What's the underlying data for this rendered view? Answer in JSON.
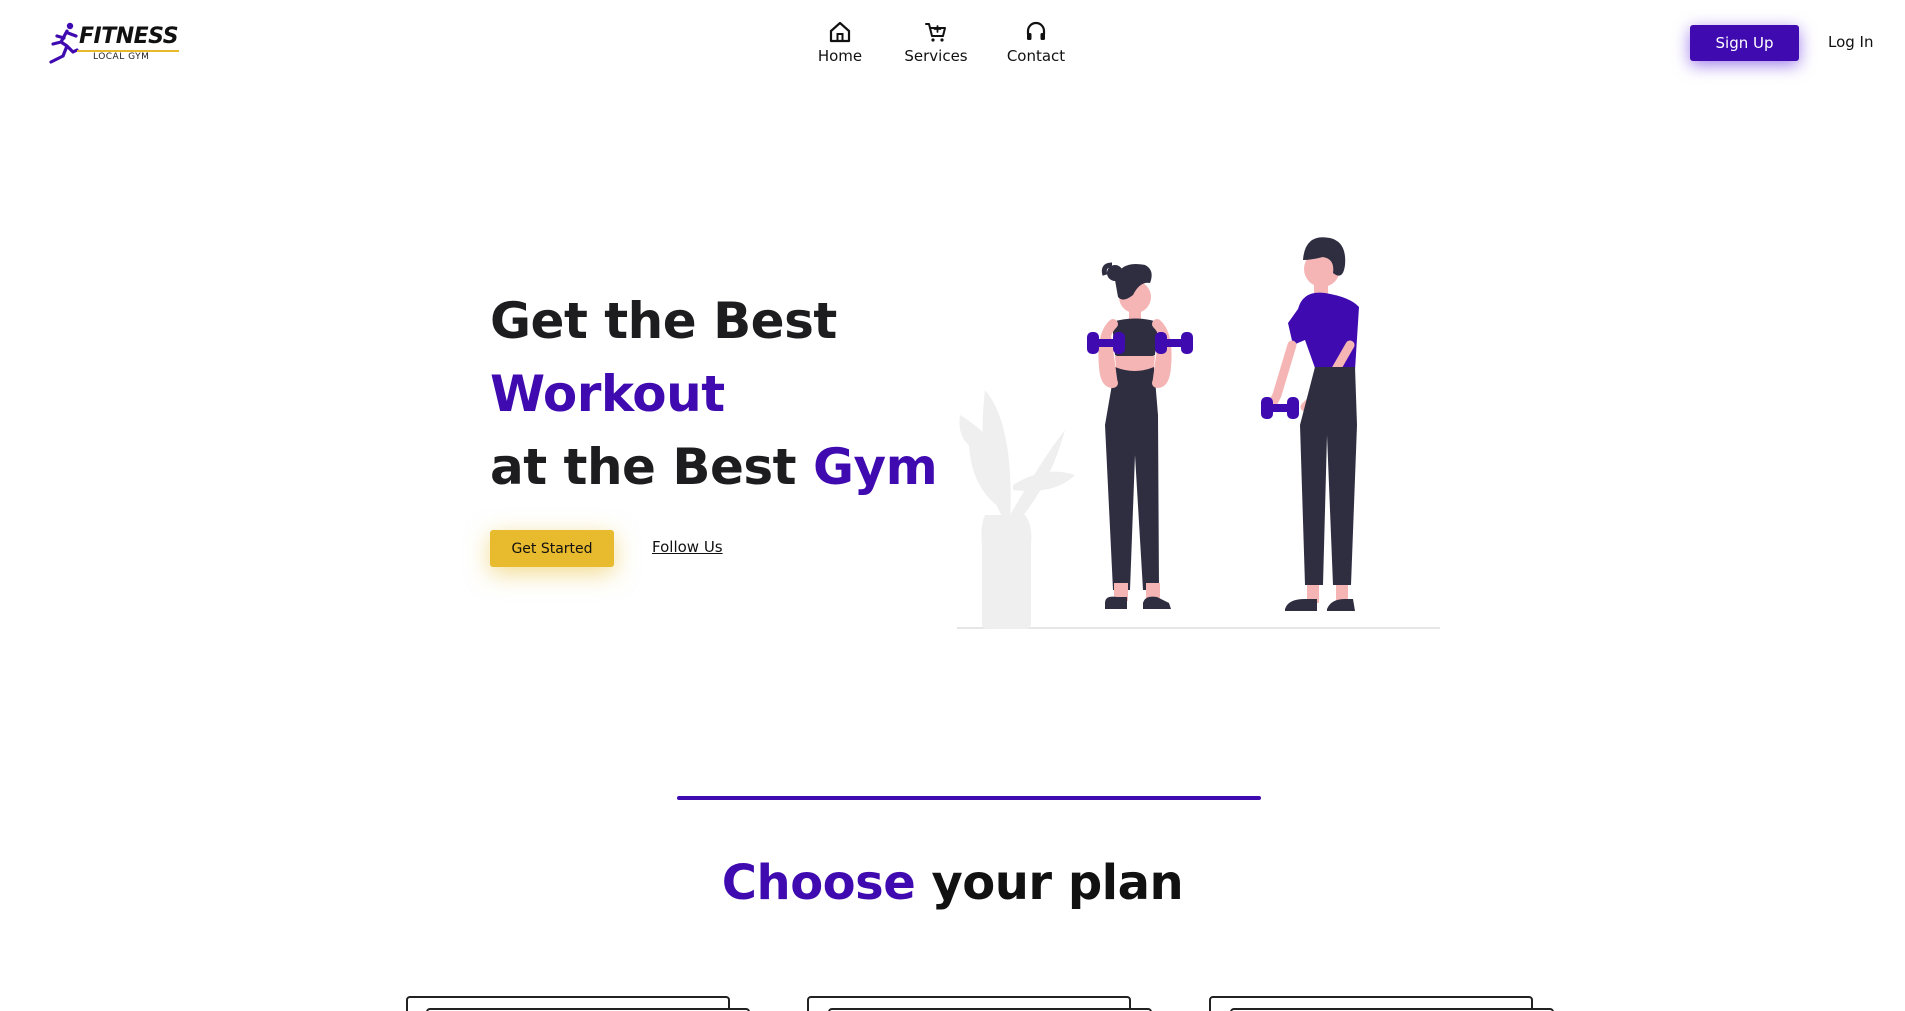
{
  "brand": {
    "title": "FITNESS",
    "subtitle": "LOCAL GYM",
    "accent_color": "#3f0ab0",
    "line_color": "#e7b92c"
  },
  "nav": {
    "items": [
      {
        "label": "Home",
        "icon": "home-icon"
      },
      {
        "label": "Services",
        "icon": "cart-icon"
      },
      {
        "label": "Contact",
        "icon": "headset-icon"
      }
    ]
  },
  "header": {
    "signup_label": "Sign Up",
    "login_label": "Log In"
  },
  "hero": {
    "line1": "Get the Best",
    "line2": "Workout",
    "line3_prefix": "at the Best ",
    "line3_accent": "Gym",
    "cta_label": "Get Started",
    "follow_label": "Follow Us",
    "cta_color": "#e8bb2e"
  },
  "plans": {
    "title_accent": "Choose",
    "title_rest": " your plan"
  },
  "colors": {
    "primary": "#3f0ab0",
    "yellow": "#e8bb2e",
    "text": "#1d1d1f"
  }
}
